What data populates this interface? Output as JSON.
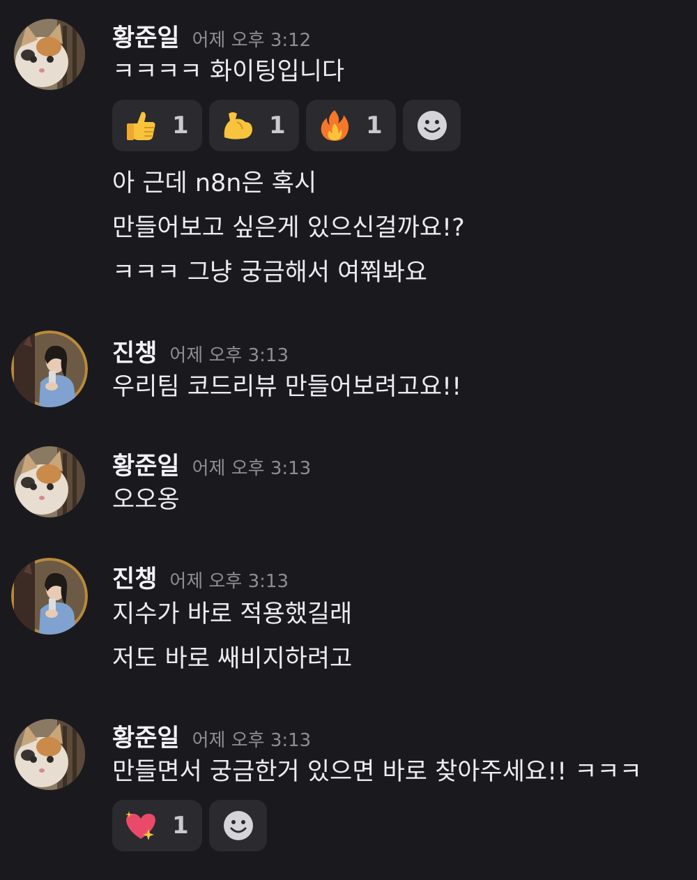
{
  "messages": [
    {
      "author": "황준일",
      "time": "어제 오후 3:12",
      "lines": [
        "ㅋㅋㅋㅋ 화이팅입니다"
      ],
      "reactions": [
        {
          "icon": "thumbs-up-icon",
          "count": "1"
        },
        {
          "icon": "flexed-biceps-icon",
          "count": "1"
        },
        {
          "icon": "fire-icon",
          "count": "1"
        }
      ],
      "extra_lines": [
        "아 근데 n8n은 혹시",
        "만들어보고 싶은게 있으신걸까요!?",
        "ㅋㅋㅋ 그냥 궁금해서 여쭤봐요"
      ]
    },
    {
      "author": "진챙",
      "time": "어제 오후 3:13",
      "lines": [
        "우리팀 코드리뷰 만들어보려고요!!"
      ]
    },
    {
      "author": "황준일",
      "time": "어제 오후 3:13",
      "lines": [
        "오오옹"
      ]
    },
    {
      "author": "진챙",
      "time": "어제 오후 3:13",
      "lines": [
        "지수가 바로 적용했길래",
        "저도 바로 쌔비지하려고"
      ]
    },
    {
      "author": "황준일",
      "time": "어제 오후 3:13",
      "lines": [
        "만들면서 궁금한거 있으면 바로 찾아주세요!! ㅋㅋㅋ"
      ],
      "reactions": [
        {
          "icon": "sparkling-heart-icon",
          "count": "1"
        }
      ]
    }
  ],
  "colors": {
    "background": "#1a1a1e",
    "reaction_bg": "#2a2a2f",
    "timestamp": "#8e8e96",
    "text": "#ececef"
  }
}
